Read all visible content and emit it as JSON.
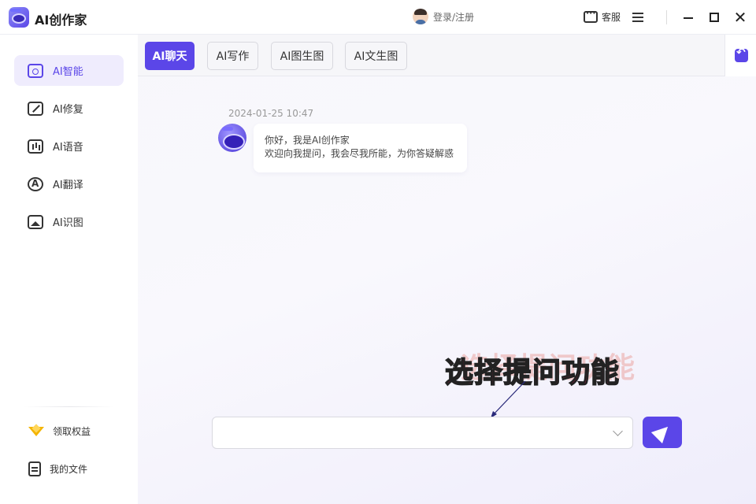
{
  "app": {
    "title": "AI创作家"
  },
  "header": {
    "login_label": "登录/注册",
    "service_label": "客服"
  },
  "sidebar": {
    "items": [
      {
        "label": "AI智能",
        "icon": "ai-chat-icon",
        "active": true
      },
      {
        "label": "AI修复",
        "icon": "repair-icon",
        "active": false
      },
      {
        "label": "AI语音",
        "icon": "voice-icon",
        "active": false
      },
      {
        "label": "AI翻译",
        "icon": "translate-icon",
        "active": false
      },
      {
        "label": "AI识图",
        "icon": "image-recognition-icon",
        "active": false
      }
    ],
    "bottom": [
      {
        "label": "领取权益",
        "icon": "crown-icon"
      },
      {
        "label": "我的文件",
        "icon": "file-icon"
      }
    ]
  },
  "tabs": [
    {
      "label": "AI聊天",
      "active": true
    },
    {
      "label": "AI写作",
      "active": false
    },
    {
      "label": "AI图生图",
      "active": false
    },
    {
      "label": "AI文生图",
      "active": false
    }
  ],
  "chat": {
    "timestamp": "2024-01-25 10:47",
    "message_lines": [
      "你好，我是AI创作家",
      "欢迎向我提问，我会尽我所能，为你答疑解惑"
    ]
  },
  "annotation": {
    "text": "选择提问功能"
  },
  "input": {
    "value": "",
    "placeholder": ""
  },
  "colors": {
    "accent": "#5b46e8",
    "annotation": "#e0194f"
  }
}
